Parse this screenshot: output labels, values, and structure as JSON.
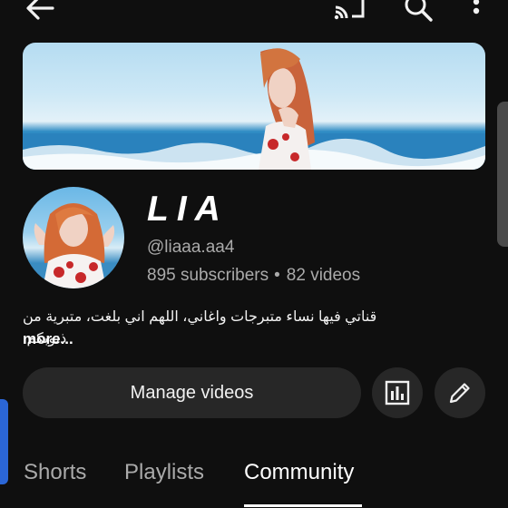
{
  "header": {
    "icons": [
      "back-icon",
      "cast-icon",
      "search-icon",
      "more-vert-icon"
    ]
  },
  "channel": {
    "name": "LIA",
    "handle": "@liaaa.aa4",
    "subscribers": "895 subscribers",
    "separator": "•",
    "videos": "82 videos",
    "description": "قناتي فيها نساء متبرجات واغاني، اللهم اني بلغت، متبرية من ذنوبكم.",
    "more_label": "more..."
  },
  "actions": {
    "manage_label": "Manage videos",
    "icons": [
      "analytics-icon",
      "edit-pencil-icon"
    ]
  },
  "tabs": [
    {
      "label": "Shorts",
      "active": false
    },
    {
      "label": "Playlists",
      "active": false
    },
    {
      "label": "Community",
      "active": true
    }
  ],
  "colors": {
    "background": "#0f0f0f",
    "button": "#272727",
    "secondary_text": "#aaaaaa"
  }
}
